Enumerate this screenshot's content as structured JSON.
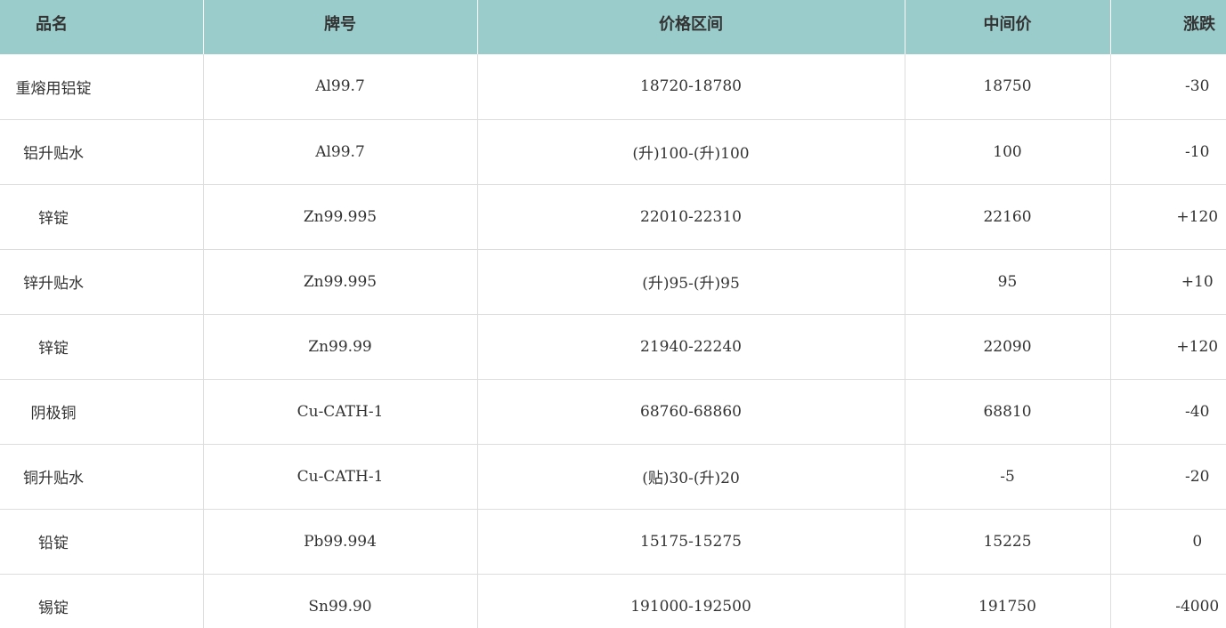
{
  "table": {
    "headers": [
      "品名",
      "牌号",
      "价格区间",
      "中间价",
      "涨跌"
    ],
    "rows": [
      {
        "name": "重熔用铝锭",
        "grade": "Al99.7",
        "range": "18720-18780",
        "mid": "18750",
        "change": "-30"
      },
      {
        "name": "铝升贴水",
        "grade": "Al99.7",
        "range": "(升)100-(升)100",
        "mid": "100",
        "change": "-10"
      },
      {
        "name": "锌锭",
        "grade": "Zn99.995",
        "range": "22010-22310",
        "mid": "22160",
        "change": "+120"
      },
      {
        "name": "锌升贴水",
        "grade": "Zn99.995",
        "range": "(升)95-(升)95",
        "mid": "95",
        "change": "+10"
      },
      {
        "name": "锌锭",
        "grade": "Zn99.99",
        "range": "21940-22240",
        "mid": "22090",
        "change": "+120"
      },
      {
        "name": "阴极铜",
        "grade": "Cu-CATH-1",
        "range": "68760-68860",
        "mid": "68810",
        "change": "-40"
      },
      {
        "name": "铜升贴水",
        "grade": "Cu-CATH-1",
        "range": "(贴)30-(升)20",
        "mid": "-5",
        "change": "-20"
      },
      {
        "name": "铅锭",
        "grade": "Pb99.994",
        "range": "15175-15275",
        "mid": "15225",
        "change": "0"
      },
      {
        "name": "锡锭",
        "grade": "Sn99.90",
        "range": "191000-192500",
        "mid": "191750",
        "change": "-4000"
      }
    ]
  },
  "colors": {
    "header_bg": "#9bcccc",
    "text": "#333333",
    "border": "#dddddd"
  }
}
